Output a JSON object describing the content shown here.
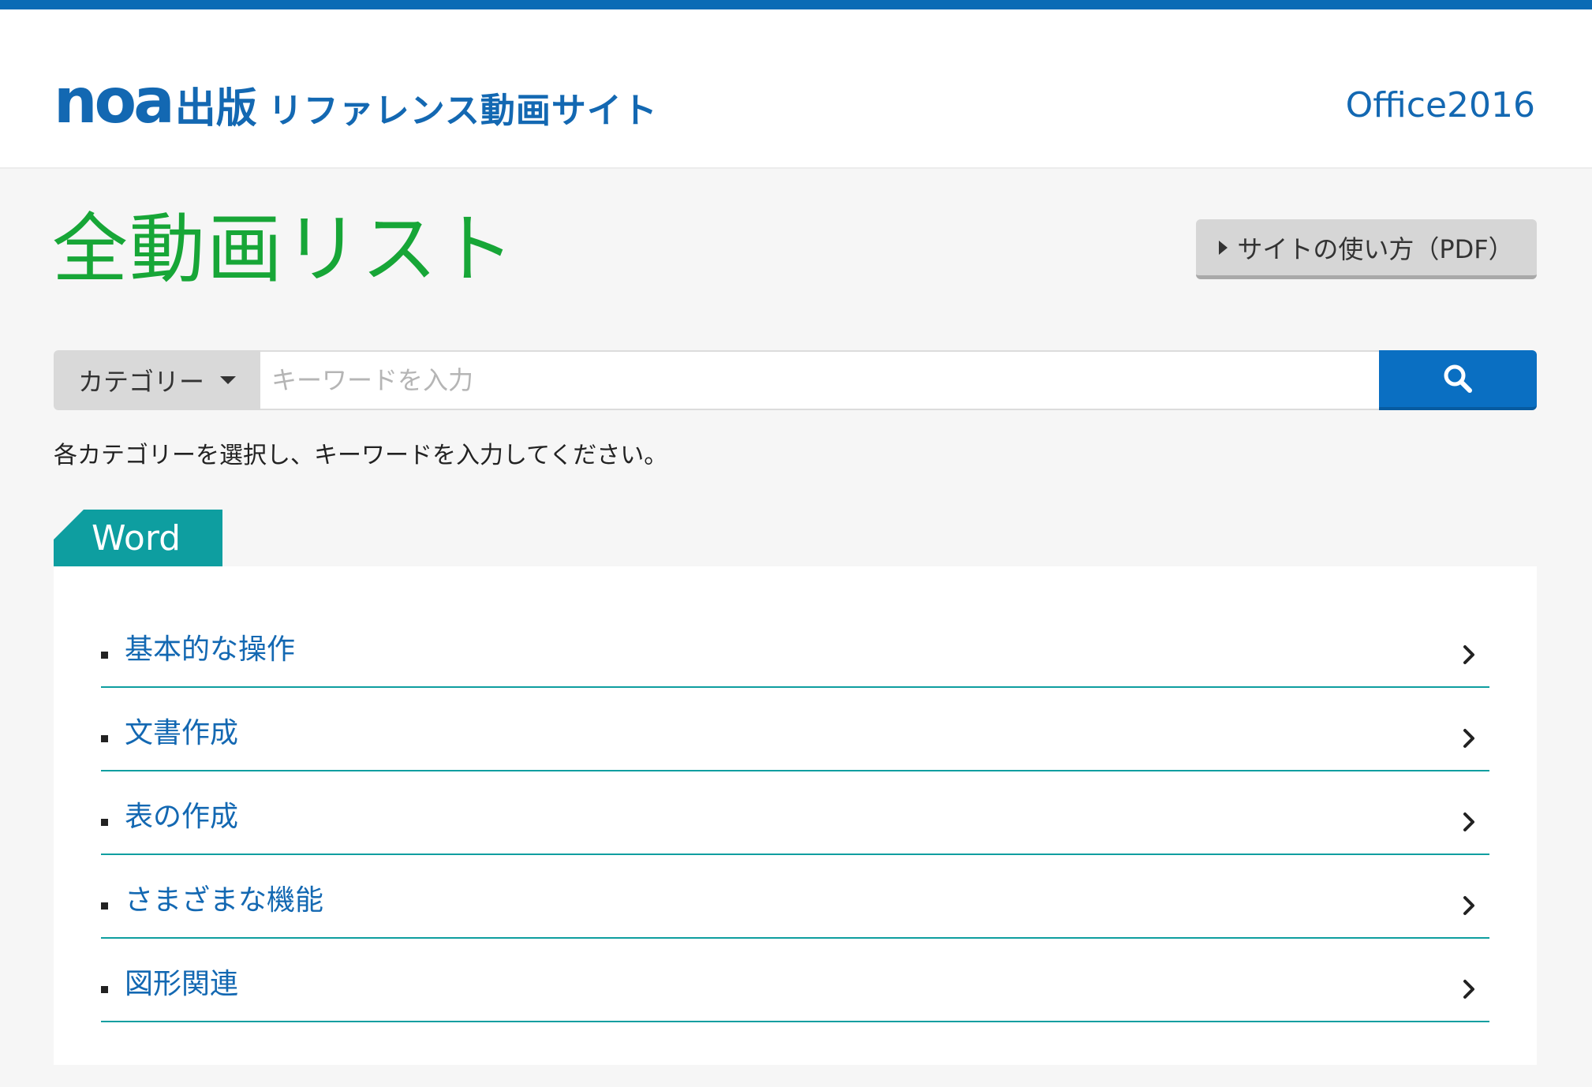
{
  "header": {
    "logo_noa": "noa",
    "logo_publisher": "出版",
    "logo_subtitle": "リファレンス動画サイト",
    "office_version": "Office2016"
  },
  "main": {
    "page_title": "全動画リスト",
    "howto_button_label": "サイトの使い方（PDF）",
    "search": {
      "category_label": "カテゴリー",
      "placeholder": "キーワードを入力"
    },
    "helper_text": "各カテゴリーを選択し、キーワードを入力してください。"
  },
  "word_section": {
    "tab_label": "Word",
    "items": [
      {
        "label": "基本的な操作"
      },
      {
        "label": "文書作成"
      },
      {
        "label": "表の作成"
      },
      {
        "label": "さまざまな機能"
      },
      {
        "label": "図形関連"
      }
    ]
  },
  "colors": {
    "brand_blue": "#1368b2",
    "title_green": "#17a637",
    "teal": "#0e9ea0",
    "search_blue": "#0a6fc2"
  },
  "icons": {
    "search": "search-icon",
    "caret": "caret-down-icon",
    "chevron": "chevron-right-icon",
    "play": "play-triangle-icon"
  }
}
